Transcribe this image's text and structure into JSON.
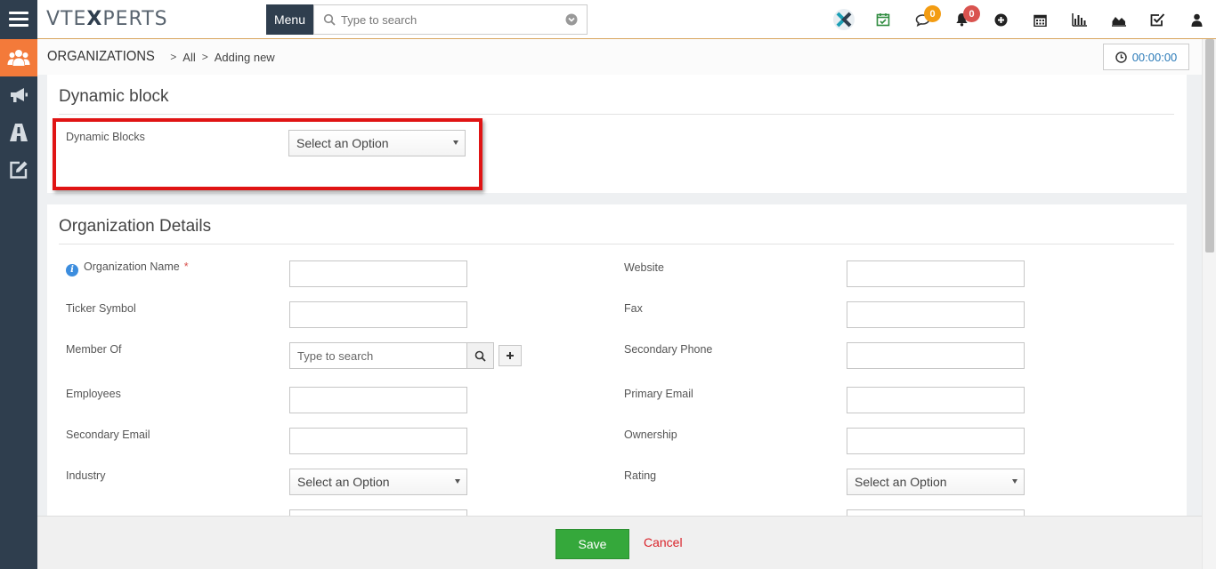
{
  "app": {
    "logo": {
      "prefix": "VTE",
      "mark": "X",
      "suffix": "PERTS"
    },
    "menu_label": "Menu",
    "search_placeholder": "Type to search"
  },
  "header_icons": [
    {
      "name": "vtex-logo-icon"
    },
    {
      "name": "calendar-check-icon",
      "color": "#2e8b3e"
    },
    {
      "name": "chat-icon",
      "badge": "0",
      "badge_color": "#f39c12"
    },
    {
      "name": "bell-icon",
      "badge": "0",
      "badge_color": "#d9534f"
    },
    {
      "name": "plus-circle-icon"
    },
    {
      "name": "calendar-icon"
    },
    {
      "name": "bar-chart-icon"
    },
    {
      "name": "area-chart-icon"
    },
    {
      "name": "check-square-icon"
    },
    {
      "name": "user-icon"
    }
  ],
  "sidebar": [
    {
      "name": "users-icon",
      "active": true
    },
    {
      "name": "megaphone-icon",
      "active": false
    },
    {
      "name": "road-icon",
      "active": false
    },
    {
      "name": "edit-icon",
      "active": false
    }
  ],
  "breadcrumb": {
    "module": "ORGANIZATIONS",
    "filter": "All",
    "action": "Adding new"
  },
  "timer": "00:00:00",
  "dynamic_block": {
    "title": "Dynamic block",
    "field_label": "Dynamic Blocks",
    "field_value": "Select an Option"
  },
  "org_details": {
    "title": "Organization Details",
    "left_fields": [
      {
        "label": "Organization Name",
        "required": "*"
      },
      {
        "label": "Ticker Symbol"
      },
      {
        "label": "Member Of",
        "placeholder": "Type to search"
      },
      {
        "label": "Employees"
      },
      {
        "label": "Secondary Email"
      },
      {
        "label": "Industry",
        "value": "Select an Option"
      }
    ],
    "right_fields": [
      {
        "label": "Website"
      },
      {
        "label": "Fax"
      },
      {
        "label": "Secondary Phone"
      },
      {
        "label": "Primary Email"
      },
      {
        "label": "Ownership"
      },
      {
        "label": "Rating",
        "value": "Select an Option"
      }
    ]
  },
  "footer": {
    "save_label": "Save",
    "cancel_label": "Cancel"
  }
}
